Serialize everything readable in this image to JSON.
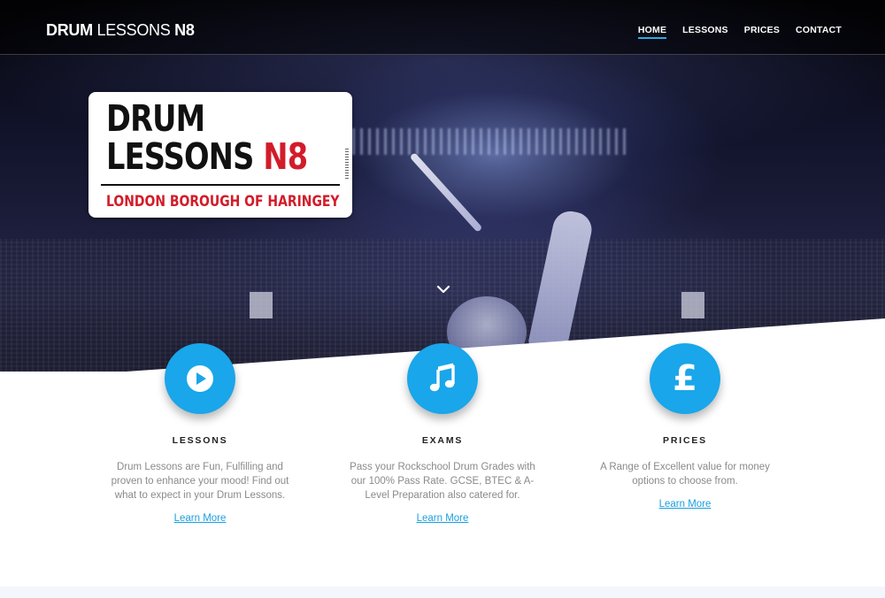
{
  "brand": {
    "part1": "DRUM",
    "part2": "LESSONS",
    "part3": "N8"
  },
  "nav": {
    "items": [
      "HOME",
      "LESSONS",
      "PRICES",
      "CONTACT"
    ],
    "active": "HOME"
  },
  "hero": {
    "sign": {
      "line1": "DRUM",
      "line2_a": "LESSONS",
      "line2_b": "N8",
      "borough": "LONDON BOROUGH OF HARINGEY"
    },
    "scroll_icon": "chevron-down-icon"
  },
  "features": [
    {
      "icon": "play-icon",
      "title": "LESSONS",
      "description": "Drum Lessons are Fun, Fulfilling and proven to enhance your mood! Find out what to expect in your Drum Lessons.",
      "link": "Learn More"
    },
    {
      "icon": "music-note-icon",
      "title": "EXAMS",
      "description": "Pass your Rockschool Drum Grades with our 100% Pass Rate. GCSE, BTEC & A-Level Preparation also catered for.",
      "link": "Learn More"
    },
    {
      "icon": "pound-icon",
      "title": "PRICES",
      "description": "A Range of Excellent value for money options to choose from.",
      "link": "Learn More",
      "pound_symbol": "£"
    }
  ],
  "colors": {
    "accent": "#19a6ea",
    "sign_red": "#d21c2a",
    "nav_underline": "#2aaae8"
  }
}
